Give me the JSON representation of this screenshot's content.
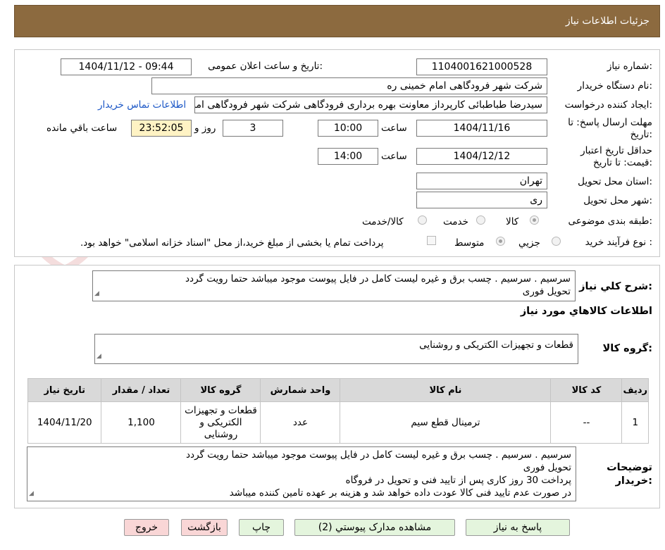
{
  "header": {
    "title": "جزئیات اطلاعات نیاز"
  },
  "watermark": {
    "text": "AriaTender.neT"
  },
  "form": {
    "need_number_label": "شماره نیاز:",
    "need_number": "1104001621000528",
    "announce_label": "تاریخ و ساعت اعلان عمومی:",
    "announce_value": "1404/11/12 - 09:44",
    "buyer_org_label": "نام دستگاه خریدار:",
    "buyer_org": "شرکت شهر فرودگاهی امام خمینی  ره",
    "creator_label": "ایجاد کننده درخواست:",
    "creator": "سیدرضا طباطبائی کارپرداز معاونت بهره برداری فرودگاهی شرکت شهر فرودگاهی امام",
    "contact_link": "اطلاعات تماس خریدار",
    "deadline_label_1": "مهلت ارسال پاسخ: تا",
    "deadline_label_2": "تاریخ:",
    "deadline_date": "1404/11/16",
    "time_label": "ساعت",
    "deadline_time": "10:00",
    "days_value": "3",
    "days_label": "روز و",
    "remaining_time": "23:52:05",
    "remaining_label": "ساعت باقي مانده",
    "validity_label_1": "حداقل تاریخ اعتبار",
    "validity_label_2": "قیمت: تا تاریخ:",
    "validity_date": "1404/12/12",
    "validity_time": "14:00",
    "province_label": "استان محل تحویل:",
    "province": "تهران",
    "city_label": "شهر محل تحویل:",
    "city": "ری",
    "category_label": "طبقه بندی موضوعی:",
    "category_options": [
      "کالا",
      "خدمت",
      "کالا/خدمت"
    ],
    "category_selected": "کالا",
    "process_label": "نوع فرآیند خرید :",
    "process_options": [
      "جزیي",
      "متوسط"
    ],
    "process_selected": "متوسط",
    "payment_note": "پرداخت تمام یا بخشی از مبلغ خرید،از محل \"اسناد خزانه اسلامی\" خواهد بود."
  },
  "summary": {
    "label": "شرح کلي نياز:",
    "text_line1": "سرسیم . سرسیم  .  چسب برق و غیره لیست کامل در فایل پیوست موجود میباشد حتما رویت گردد",
    "text_line2": "تحویل فوری",
    "goods_info_title": "اطلاعات کالاهاي مورد نياز",
    "goods_group_label": "گروه کالا:",
    "goods_group": "قطعات و تجهیزات الکتریکی و روشنایی"
  },
  "table": {
    "headers": [
      "ردیف",
      "کد کالا",
      "نام کالا",
      "واحد شمارش",
      "گروه کالا",
      "تعداد / مقدار",
      "تاریخ نیاز"
    ],
    "rows": [
      {
        "row": "1",
        "code": "--",
        "name": "ترمینال قطع سیم",
        "unit": "عدد",
        "group_line1": "قطعات و تجهیزات",
        "group_line2": "الکتریکی و",
        "group_line3": "روشنایی",
        "qty": "1,100",
        "date": "1404/11/20"
      }
    ]
  },
  "buyer_notes": {
    "label_line1": "توضیحات",
    "label_line2": "خریدار:",
    "lines": [
      "سرسیم . سرسیم  .  چسب برق و غیره لیست کامل در فایل پیوست موجود میباشد حتما رویت گردد",
      "تحویل فوری",
      "پرداخت 30 روز کاری پس از تایید فنی و تحویل در فروگاه",
      "در صورت عدم تایید فنی کالا عودت داده خواهد شد و هزینه بر عهده تامین کننده میباشد"
    ]
  },
  "buttons": {
    "reply": "پاسخ به نیاز",
    "view_docs": "مشاهده مدارک پیوستي (2)",
    "print": "چاپ",
    "back": "بازگشت",
    "exit": "خروج"
  },
  "colors": {
    "header_bg": "#8c6a3f",
    "timer_bg": "#fff3c4",
    "button_green": "#e4f5dd",
    "button_red": "#f9d6d6",
    "link": "#1a56c6"
  }
}
